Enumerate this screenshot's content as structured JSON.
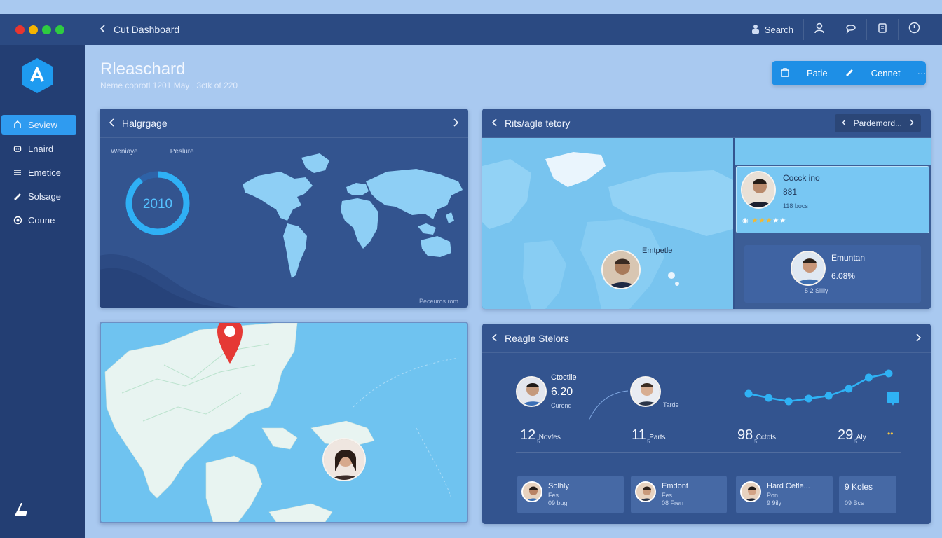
{
  "window": {
    "title": "Cut Dashboard",
    "traffic_colors": [
      "#e8352f",
      "#f4b400",
      "#2ecc40",
      "#2ecc40"
    ]
  },
  "topbar": {
    "search_label": "Search"
  },
  "sidebar": {
    "items": [
      {
        "label": "Seview",
        "icon": "home-icon",
        "active": true
      },
      {
        "label": "Lnaird",
        "icon": "bot-icon"
      },
      {
        "label": "Emetice",
        "icon": "list-icon"
      },
      {
        "label": "Solsage",
        "icon": "pen-icon"
      },
      {
        "label": "Coune",
        "icon": "gear-icon"
      }
    ]
  },
  "header": {
    "title": "Rleaschard",
    "subtitle": "Neme coprotl 1201 May , 3ctk of 220"
  },
  "actions": {
    "first": "Patie",
    "second": "Cennet",
    "more": "···"
  },
  "panel1": {
    "title": "Halgrgage",
    "tab1": "Weniaye",
    "tab2": "Peslure",
    "donut_value": "2010",
    "donut_fraction": 0.9,
    "footer": "Peceuros  rom"
  },
  "panel2": {
    "title": "Rits/agle tetory",
    "button": "Pardemord...",
    "map_label": "Emtpetle",
    "card1": {
      "name": "Cocck ino",
      "value": "881",
      "sub": "118 bocs"
    },
    "card2": {
      "name": "Emuntan",
      "value": "6.08%",
      "sub": "5 2 Silliy"
    }
  },
  "panel4": {
    "title": "Reagle Stelors",
    "person1": {
      "name": "Ctoctile",
      "value": "6.20",
      "sub": "Curend"
    },
    "person2": {
      "sub": "Tarde"
    },
    "stats": [
      {
        "big": "12",
        "label": "Novfes",
        "sub": "5"
      },
      {
        "big": "11",
        "label": "Parts",
        "sub": "5"
      },
      {
        "big": "98",
        "label": "Cctots",
        "sub": "5"
      },
      {
        "big": "29",
        "label": "Aly",
        "sub": "5"
      }
    ],
    "trend": [
      42,
      48,
      53,
      49,
      45,
      35,
      19,
      13
    ],
    "cards": [
      {
        "name": "Solhly",
        "sub": "Fes",
        "extra": "09 bug"
      },
      {
        "name": "Emdont",
        "sub": "Fes",
        "extra": "08 Fren"
      },
      {
        "name": "Hard Cefle...",
        "sub": "Pon",
        "extra": "9 9ily"
      },
      {
        "name": "9 Koles",
        "sub": "",
        "extra": "09 Bcs"
      }
    ]
  }
}
